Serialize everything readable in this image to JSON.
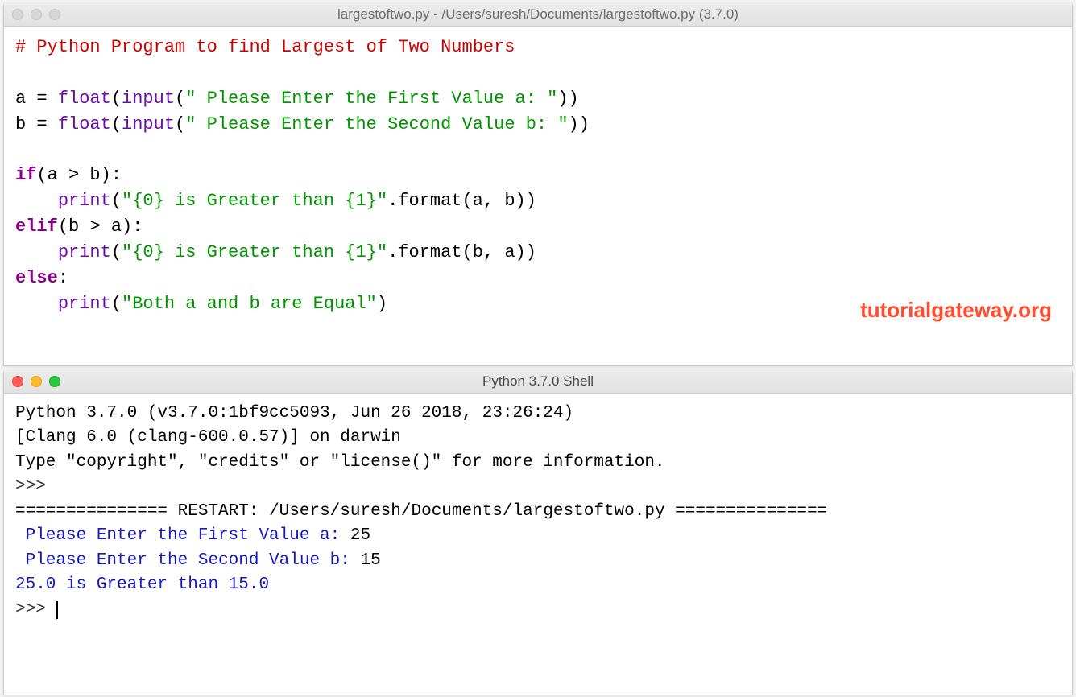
{
  "editor": {
    "title": "largestoftwo.py - /Users/suresh/Documents/largestoftwo.py (3.7.0)",
    "code": {
      "comment": "# Python Program to find Largest of Two Numbers",
      "a_var": "a",
      "b_var": "b",
      "eq": " = ",
      "float": "float",
      "input": "input",
      "lp": "(",
      "rp": ")",
      "rp2": "))",
      "str_prompt_a": "\" Please Enter the First Value a: \"",
      "str_prompt_b": "\" Please Enter the Second Value b: \"",
      "if": "if",
      "elif": "elif",
      "else": "else",
      "cond_ab": "(a > b):",
      "cond_ba": "(b > a):",
      "colon": ":",
      "indent": "    ",
      "print": "print",
      "str_greater": "\"{0} is Greater than {1}\"",
      "str_equal": "\"Both a and b are Equal\"",
      "format": ".format",
      "args_ab": "(a, b))",
      "args_ba": "(b, a))"
    }
  },
  "shell": {
    "title": "Python 3.7.0 Shell",
    "line1": "Python 3.7.0 (v3.7.0:1bf9cc5093, Jun 26 2018, 23:26:24) ",
    "line2": "[Clang 6.0 (clang-600.0.57)] on darwin",
    "line3": "Type \"copyright\", \"credits\" or \"license()\" for more information.",
    "prompt": ">>> ",
    "restart_l": "=============== RESTART: ",
    "restart_path": "/Users/suresh/Documents/largestoftwo.py",
    "restart_r": " ===============",
    "inp1_label": " Please Enter the First Value a: ",
    "inp1_val": "25",
    "inp2_label": " Please Enter the Second Value b: ",
    "inp2_val": "15",
    "result": "25.0 is Greater than 15.0"
  },
  "watermark": "tutorialgateway.org"
}
